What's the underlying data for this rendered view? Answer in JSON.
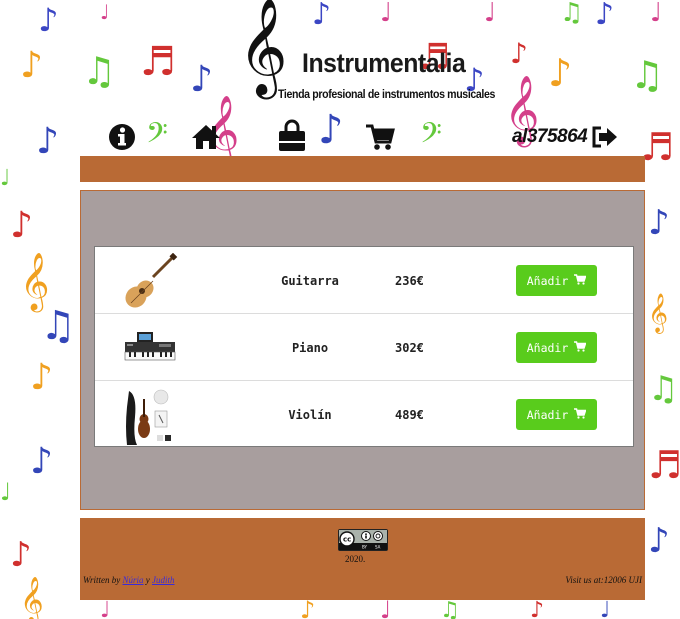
{
  "header": {
    "title": "Instrumentalia",
    "subtitle": "Tienda profesional de instrumentos musicales",
    "username": "al375864"
  },
  "nav": {
    "icons": [
      "info-icon",
      "home-icon",
      "shopping-bag-icon",
      "cart-icon",
      "logout-icon"
    ]
  },
  "products": [
    {
      "name": "Guitarra",
      "price": "236€",
      "button_label": "Añadir",
      "image": "guitar-image"
    },
    {
      "name": "Piano",
      "price": "302€",
      "button_label": "Añadir",
      "image": "keyboard-image"
    },
    {
      "name": "Violín",
      "price": "489€",
      "button_label": "Añadir",
      "image": "violin-image"
    }
  ],
  "footer": {
    "license_badge": "cc-by-sa",
    "year": "2020.",
    "written_by": "Written by",
    "author1": "Núria",
    "and": "y",
    "author2": "Judith",
    "visit": "Visit us at:12006 UJI"
  },
  "colors": {
    "brown": "#b96a35",
    "panel_gray": "#a89e9e",
    "button_green": "#59cc1c"
  }
}
